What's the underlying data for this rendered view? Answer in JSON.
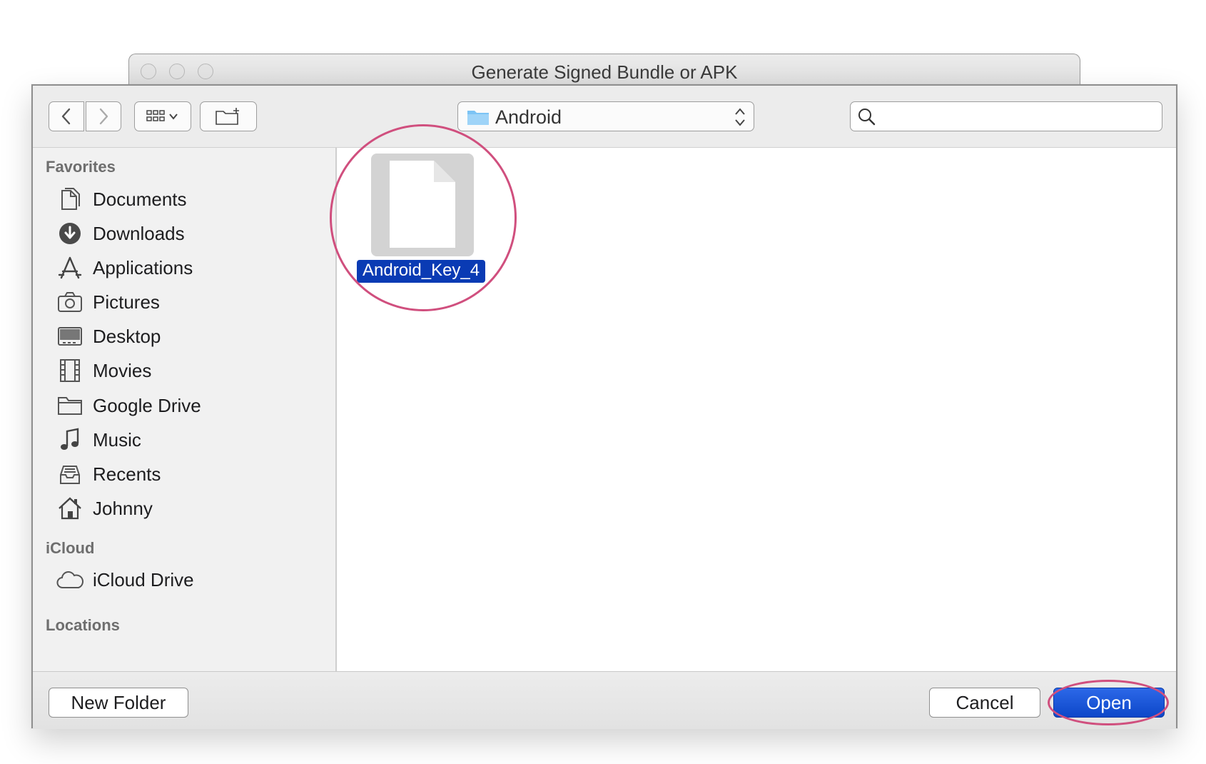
{
  "window": {
    "title": "Generate Signed Bundle or APK"
  },
  "toolbar": {
    "path_label": "Android",
    "search_placeholder": ""
  },
  "sidebar": {
    "favorites_header": "Favorites",
    "favorites": [
      {
        "label": "Documents",
        "icon": "documents-icon"
      },
      {
        "label": "Downloads",
        "icon": "downloads-icon"
      },
      {
        "label": "Applications",
        "icon": "applications-icon"
      },
      {
        "label": "Pictures",
        "icon": "camera-icon"
      },
      {
        "label": "Desktop",
        "icon": "desktop-icon"
      },
      {
        "label": "Movies",
        "icon": "film-icon"
      },
      {
        "label": "Google Drive",
        "icon": "folder-icon"
      },
      {
        "label": "Music",
        "icon": "music-note-icon"
      },
      {
        "label": "Recents",
        "icon": "recents-icon"
      },
      {
        "label": "Johnny",
        "icon": "home-icon"
      }
    ],
    "icloud_header": "iCloud",
    "icloud": [
      {
        "label": "iCloud Drive",
        "icon": "cloud-icon"
      }
    ],
    "locations_header": "Locations"
  },
  "files": [
    {
      "name": "Android_Key_4",
      "selected": true
    }
  ],
  "bottom": {
    "new_folder": "New Folder",
    "cancel": "Cancel",
    "open": "Open"
  },
  "colors": {
    "selection": "#0a3bb4",
    "annotation": "#d04f7e",
    "primary_button": "#0d47c9"
  }
}
